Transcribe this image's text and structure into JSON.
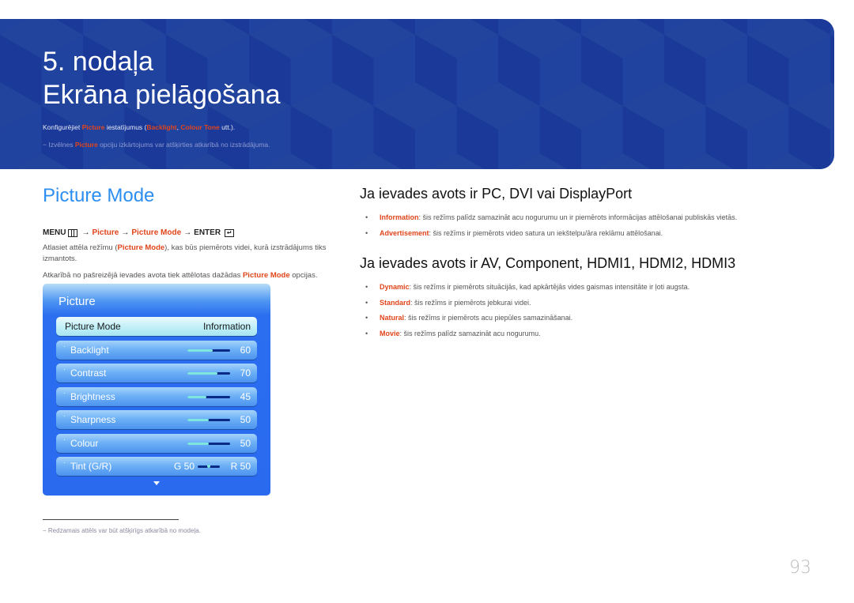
{
  "banner": {
    "chapter": "5. nodaļa",
    "title": "Ekrāna pielāgošana",
    "intro": {
      "prefix": "Konfigurējiet ",
      "picture": "Picture",
      "mid": " iestatījumus (",
      "backlight": "Backlight",
      "comma": ", ",
      "colour_tone": "Colour Tone",
      "suffix": " utt.)."
    },
    "note": {
      "dash": "−",
      "prefix": " Izvēlnes ",
      "picture": "Picture",
      "suffix": " opciju izkārtojums var atšķirties atkarībā no izstrādājuma."
    },
    "colors": {
      "background": "#1f3f98",
      "highlight": "#e0451b"
    }
  },
  "left": {
    "section_title": "Picture Mode",
    "menu_path": {
      "menu": "MENU",
      "arrow": "→",
      "picture": "Picture",
      "picture_mode": "Picture Mode",
      "enter": "ENTER",
      "enter_glyph": "↵"
    },
    "para1": {
      "prefix": "Atlasiet attēla režīmu (",
      "bold": "Picture Mode",
      "suffix": "), kas būs piemērots videi, kurā izstrādājums tiks izmantots."
    },
    "para2": {
      "prefix": "Atkarībā no pašreizējā ievades avota tiek attēlotas dažādas ",
      "bold": "Picture Mode",
      "suffix": " opcijas."
    },
    "osd": {
      "title": "Picture",
      "selected": {
        "label": "Picture Mode",
        "value": "Information"
      },
      "items": [
        {
          "label": "Backlight",
          "value": "60",
          "level": 0.6
        },
        {
          "label": "Contrast",
          "value": "70",
          "level": 0.7
        },
        {
          "label": "Brightness",
          "value": "45",
          "level": 0.45
        },
        {
          "label": "Sharpness",
          "value": "50",
          "level": 0.5
        },
        {
          "label": "Colour",
          "value": "50",
          "level": 0.5
        }
      ],
      "tint": {
        "label": "Tint (G/R)",
        "g": "G 50",
        "r": "R 50"
      },
      "bullet": "·"
    },
    "footnote": {
      "dash": "−",
      "text": "Redzamais attēls var būt atšķirīgs atkarībā no modeļa."
    }
  },
  "right": {
    "section1": {
      "title": "Ja ievades avots ir PC, DVI vai DisplayPort",
      "items": [
        {
          "term": "Information",
          "text": ": šis režīms palīdz samazināt acu nogurumu un ir piemērots informācijas attēlošanai publiskās vietās."
        },
        {
          "term": "Advertisement",
          "text": ": šis režīms ir piemērots video satura un iekštelpu/āra reklāmu attēlošanai."
        }
      ]
    },
    "section2": {
      "title": "Ja ievades avots ir AV, Component, HDMI1, HDMI2, HDMI3",
      "items": [
        {
          "term": "Dynamic",
          "text": ": šis režīms ir piemērots situācijās, kad apkārtējās vides gaismas intensitāte ir ļoti augsta."
        },
        {
          "term": "Standard",
          "text": ": šis režīms ir piemērots jebkurai videi."
        },
        {
          "term": "Natural",
          "text": ": šis režīms ir piemērots acu piepūles samazināšanai."
        },
        {
          "term": "Movie",
          "text": ": šis režīms palīdz samazināt acu nogurumu."
        }
      ]
    },
    "bullet": "•"
  },
  "page_number": "93"
}
